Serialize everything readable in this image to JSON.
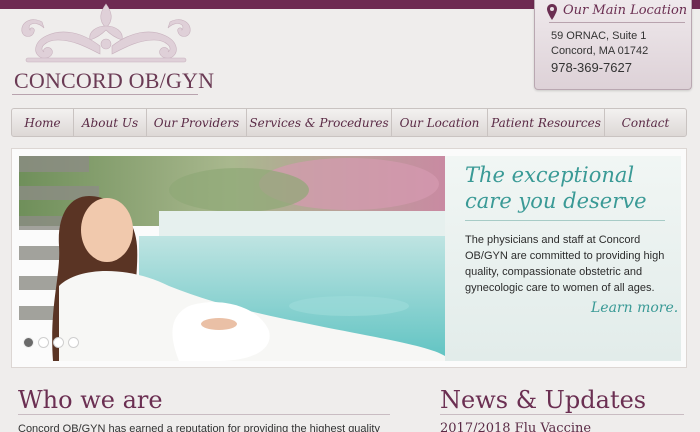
{
  "brand": {
    "name": "CONCORD OB/GYN"
  },
  "location": {
    "title": "Our Main Location",
    "address_line1": "59 ORNAC, Suite 1",
    "address_line2": "Concord, MA 01742",
    "phone": "978-369-7627"
  },
  "nav": {
    "items": [
      {
        "label": "Home"
      },
      {
        "label": "About Us"
      },
      {
        "label": "Our Providers"
      },
      {
        "label": "Services & Procedures"
      },
      {
        "label": "Our Location"
      },
      {
        "label": "Patient Resources"
      },
      {
        "label": "Contact"
      }
    ]
  },
  "hero": {
    "tagline": "The exceptional care you deserve",
    "description": "The physicians and staff at Concord OB/GYN are committed to providing high quality, compassionate obstetric and gynecologic care to women of all ages.",
    "learn_more": "Learn more.",
    "slides_total": 4,
    "slide_active": 1
  },
  "who": {
    "title": "Who we are",
    "intro": "Concord OB/GYN has earned a reputation for providing the highest quality"
  },
  "news": {
    "title": "News & Updates",
    "first_item": "2017/2018 Flu Vaccine"
  },
  "colors": {
    "brand_plum": "#6e2a52",
    "accent_teal": "#3a9a96"
  }
}
